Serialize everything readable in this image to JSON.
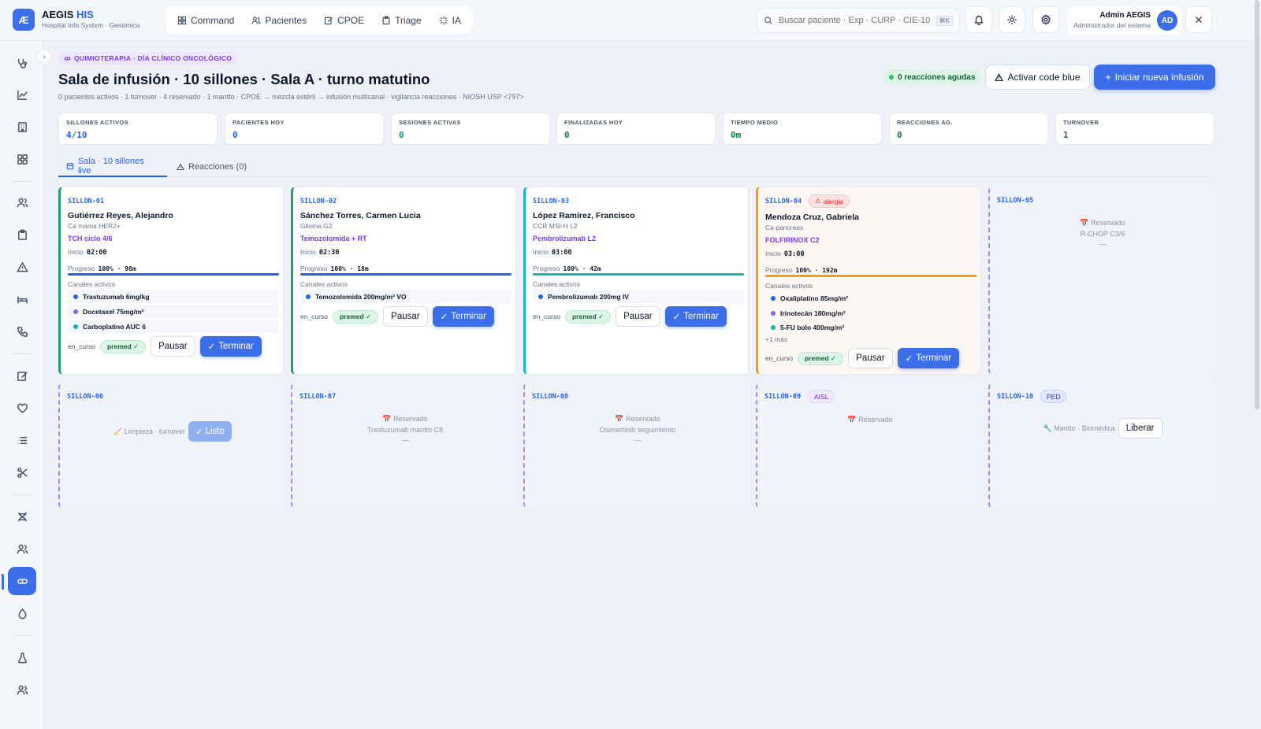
{
  "app": {
    "logo": "Æ",
    "name_main": "AEGIS",
    "name_accent": "HIS",
    "subtitle": "Hospital Info System · Genómica"
  },
  "nav": [
    {
      "label": "Command",
      "icon": "grid-icon"
    },
    {
      "label": "Pacientes",
      "icon": "users-icon"
    },
    {
      "label": "CPOE",
      "icon": "edit-icon"
    },
    {
      "label": "Triage",
      "icon": "clipboard-icon"
    },
    {
      "label": "IA",
      "icon": "sparkle-icon"
    }
  ],
  "search": {
    "placeholder": "Buscar paciente · Exp · CURP · CIE-10 · ",
    "shortcut": "⌘K"
  },
  "user": {
    "name": "Admin AEGIS",
    "role": "Administrador del sistema",
    "initials": "AD"
  },
  "header": {
    "tag": "QUIMIOTERAPIA · DÍA CLÍNICO ONCOLÓGICO",
    "title": "Sala de infusión · 10 sillones · Sala A · turno matutino",
    "subtitle": "0 pacientes activos · 1 turnover · 4 reservado · 1 mantto · CPOE → mezcla estéril → infusión multicanal · vigilancia reacciones · NIOSH USP <797>",
    "reactions_badge": "0 reacciones agudas",
    "code_blue_label": "Activar code blue",
    "new_infusion_label": "Iniciar nueva infusión"
  },
  "stats": [
    {
      "label": "SILLONES ACTIVOS",
      "value": "4/10",
      "color": "#2563eb"
    },
    {
      "label": "PACIENTES HOY",
      "value": "0",
      "color": "#2563eb"
    },
    {
      "label": "SESIONES ACTIVAS",
      "value": "0",
      "color": "#0d9488"
    },
    {
      "label": "FINALIZADAS HOY",
      "value": "0",
      "color": "#15803d"
    },
    {
      "label": "TIEMPO MEDIO",
      "value": "0m",
      "color": "#15803d"
    },
    {
      "label": "REACCIONES AG.",
      "value": "0",
      "color": "#15803d"
    },
    {
      "label": "TURNOVER",
      "value": "1",
      "color": "#475569"
    }
  ],
  "tabs": [
    {
      "label": "Sala · 10 sillones live"
    },
    {
      "label": "Reacciones (0)"
    }
  ],
  "common": {
    "start_label": "Inicio",
    "progress_label": "Progreso",
    "channels_label": "Canales activos",
    "status": "en_curso",
    "premed": "premed ✓",
    "pause": "Pausar",
    "end": "Terminar"
  },
  "chairs": [
    {
      "id": "SILLON-01",
      "patient": "Gutiérrez Reyes, Alejandro",
      "dx": "Ca mama HER2+",
      "protocol": "TCH ciclo 4/6",
      "start": "02:00",
      "progress_text": "100% · 98m",
      "progress": 1.0,
      "bar_color": "#2563eb",
      "channels": [
        {
          "name": "Trastuzumab 6mg/kg",
          "color": "#2563eb"
        },
        {
          "name": "Docetaxel 75mg/m²",
          "color": "#8b5cf6"
        },
        {
          "name": "Carboplatino AUC 6",
          "color": "#14b8a6"
        }
      ]
    },
    {
      "id": "SILLON-02",
      "patient": "Sánchez Torres, Carmen Lucia",
      "dx": "Glioma G2",
      "protocol": "Temozolomida + RT",
      "start": "02:30",
      "progress_text": "100% · 18m",
      "progress": 1.0,
      "bar_color": "#2563eb",
      "channels": [
        {
          "name": "Temozolomida 200mg/m² VO",
          "color": "#2563eb"
        }
      ]
    },
    {
      "id": "SILLON-03",
      "patient": "López Ramírez, Francisco",
      "dx": "CCR MSI-H L2",
      "protocol": "Pembrolizumab L2",
      "start": "03:00",
      "progress_text": "100% · 42m",
      "progress": 1.0,
      "bar_color": "#14b8a6",
      "channels": [
        {
          "name": "Pembrolizumab 200mg IV",
          "color": "#2563eb"
        }
      ]
    },
    {
      "id": "SILLON-04",
      "flag": "alergia",
      "patient": "Mendoza Cruz, Gabriela",
      "dx": "Ca páncreas",
      "protocol": "FOLFIRINOX C2",
      "start": "03:00",
      "progress_text": "100% · 192m",
      "progress": 1.0,
      "bar_color": "#f59e0b",
      "channels": [
        {
          "name": "Oxaliplatino 85mg/m²",
          "color": "#2563eb"
        },
        {
          "name": "Irinotecán 180mg/m²",
          "color": "#8b5cf6"
        },
        {
          "name": "5-FU bolo 400mg/m²",
          "color": "#14b8a6"
        }
      ],
      "more": "+1 más"
    },
    {
      "id": "SILLON-05",
      "reserved": "📅 Reservado",
      "detail": "R-CHOP C3/6",
      "dash": "—"
    },
    {
      "id": "SILLON-06",
      "state": "🧹 Limpieza · turnover",
      "action": "Listo"
    },
    {
      "id": "SILLON-07",
      "reserved": "📅 Reservado",
      "detail": "Trastuzumab mantto C8",
      "dash": "—"
    },
    {
      "id": "SILLON-08",
      "reserved": "📅 Reservado",
      "detail": "Osimertinib seguimiento",
      "dash": "—"
    },
    {
      "id": "SILLON-09",
      "flag": "AISL",
      "reserved": "📅 Reservado"
    },
    {
      "id": "SILLON-10",
      "flag": "PED",
      "state": "🔧 Mantto · Biomédica",
      "action": "Liberar"
    }
  ]
}
